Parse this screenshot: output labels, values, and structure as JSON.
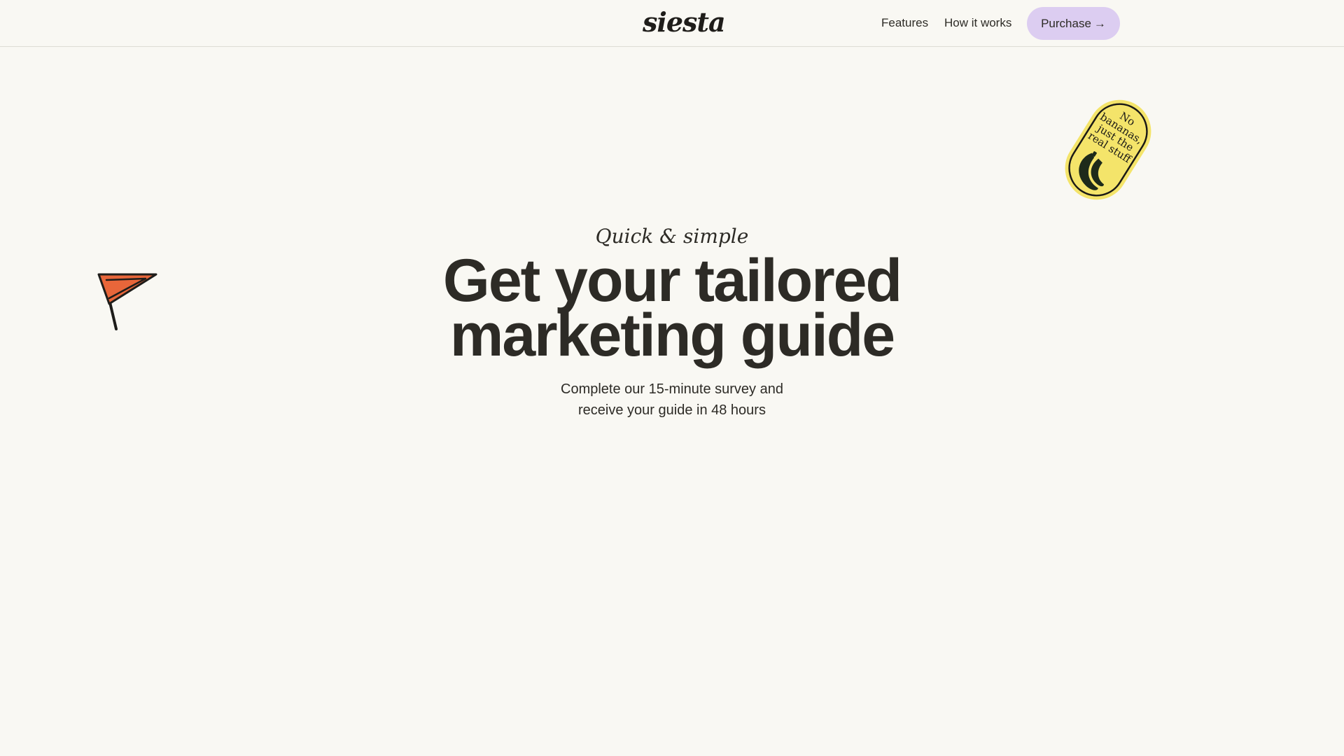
{
  "header": {
    "logo": "siesta",
    "nav": [
      {
        "label": "Features"
      },
      {
        "label": "How it works"
      }
    ],
    "purchase_label": "Purchase",
    "purchase_arrow": "→"
  },
  "hero": {
    "eyebrow": "Quick & simple",
    "headline_line1": "Get your tailored",
    "headline_line2": "marketing guide",
    "subtitle_line1": "Complete our 15-minute survey and",
    "subtitle_line2": "receive your guide in 48 hours"
  },
  "sticker": {
    "lines": [
      "No",
      "bananas,",
      "just the",
      "real stuff"
    ]
  },
  "colors": {
    "background": "#f9f8f3",
    "text": "#2d2b26",
    "purchase_button": "#dccdf1",
    "flag": "#e8663a",
    "sticker": "#f4e46a"
  },
  "icons": {
    "flag": "flag-icon",
    "banana": "banana-icon",
    "arrow": "arrow-right-icon"
  }
}
